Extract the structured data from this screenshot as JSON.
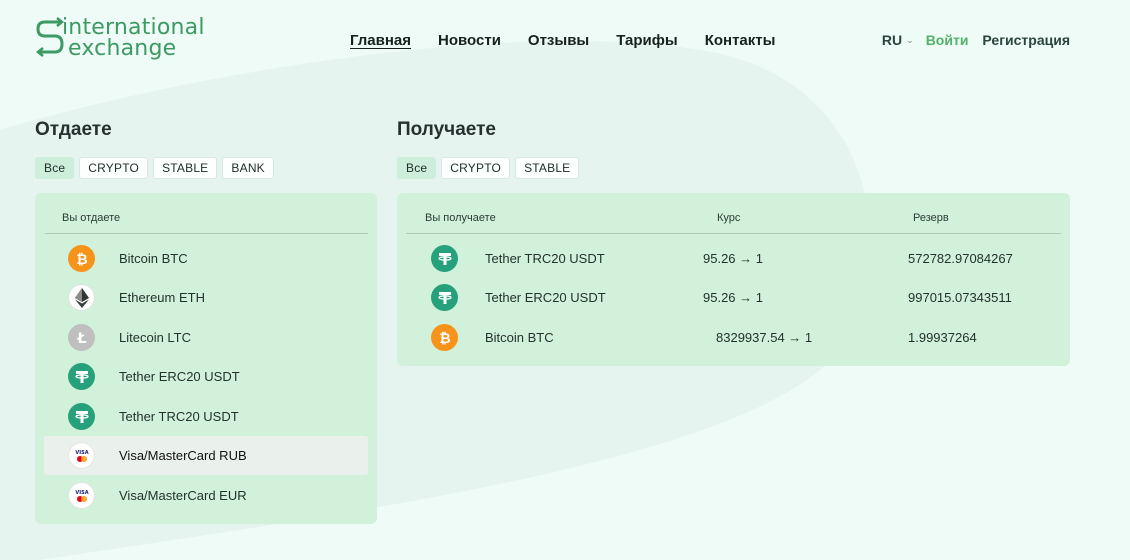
{
  "header": {
    "logo": {
      "line1": "international",
      "line2": "exchange"
    },
    "nav": [
      {
        "label": "Главная",
        "active": true
      },
      {
        "label": "Новости"
      },
      {
        "label": "Отзывы"
      },
      {
        "label": "Тарифы"
      },
      {
        "label": "Контакты"
      }
    ],
    "lang": "RU",
    "login": "Войти",
    "register": "Регистрация"
  },
  "give": {
    "title": "Отдаете",
    "filters": [
      {
        "label": "Все",
        "active": true
      },
      {
        "label": "CRYPTO"
      },
      {
        "label": "STABLE"
      },
      {
        "label": "BANK"
      }
    ],
    "column": "Вы отдаете",
    "items": [
      {
        "label": "Bitcoin BTC",
        "icon": "bitcoin-icon"
      },
      {
        "label": "Ethereum ETH",
        "icon": "ethereum-icon"
      },
      {
        "label": "Litecoin LTC",
        "icon": "litecoin-icon"
      },
      {
        "label": "Tether ERC20 USDT",
        "icon": "tether-icon"
      },
      {
        "label": "Tether TRC20 USDT",
        "icon": "tether-icon"
      },
      {
        "label": "Visa/MasterCard RUB",
        "icon": "visa-mastercard-icon",
        "hover": true
      },
      {
        "label": "Visa/MasterCard EUR",
        "icon": "visa-mastercard-icon"
      }
    ]
  },
  "receive": {
    "title": "Получаете",
    "filters": [
      {
        "label": "Все",
        "active": true
      },
      {
        "label": "CRYPTO"
      },
      {
        "label": "STABLE"
      }
    ],
    "columns": {
      "name": "Вы получаете",
      "rate": "Курс",
      "reserve": "Резерв"
    },
    "items": [
      {
        "label": "Tether TRC20 USDT",
        "icon": "tether-icon",
        "rate": "95.26 → 1",
        "reserve": "572782.97084267"
      },
      {
        "label": "Tether ERC20 USDT",
        "icon": "tether-icon",
        "rate": "95.26 → 1",
        "reserve": "997015.07343511"
      },
      {
        "label": "Bitcoin BTC",
        "icon": "bitcoin-icon",
        "rate": "8329937.54 → 1",
        "reserve": "1.99937264"
      }
    ]
  },
  "colors": {
    "background": "#eefbf6",
    "panel": "#d2f1da",
    "accent": "#52b26a",
    "bitcoin": "#f7931a",
    "tether": "#26a17b",
    "litecoin": "#bfbfbf"
  }
}
